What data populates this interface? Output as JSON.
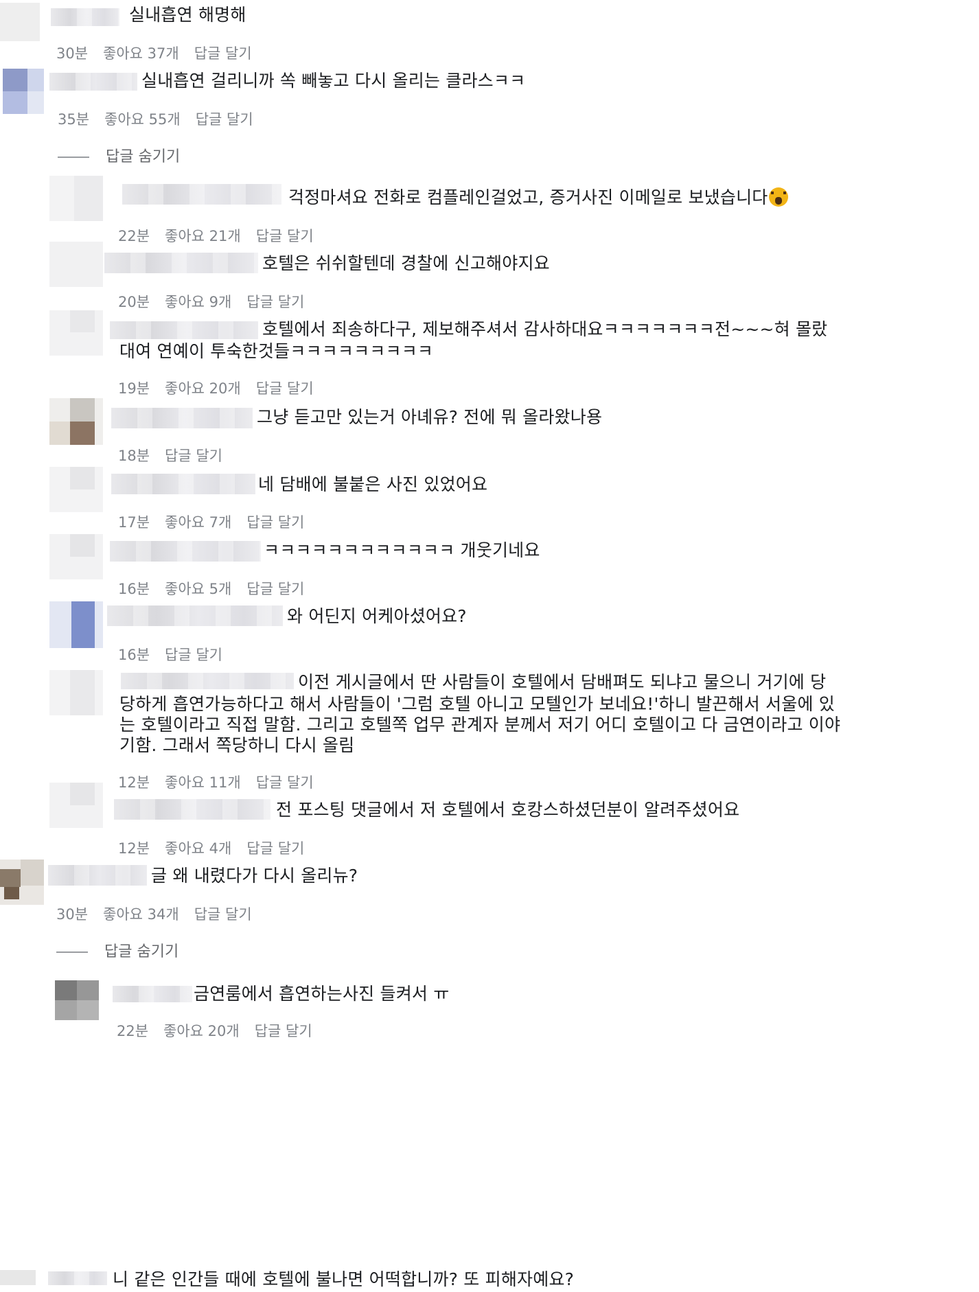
{
  "hide_replies_label": "답글 숨기기",
  "comments": [
    {
      "text": "실내흡연 해명해",
      "time": "30분",
      "likes": "좋아요 37개",
      "reply": "답글 달기"
    },
    {
      "text": "실내흡연 걸리니까 쏙 빼놓고 다시 올리는 클라스ㅋㅋ",
      "time": "35분",
      "likes": "좋아요 55개",
      "reply": "답글 달기"
    },
    {
      "text": "걱정마셔요 전화로 컴플레인걸었고, 증거사진 이메일로 보냈습니다",
      "emoji": "face-screaming-icon",
      "time": "22분",
      "likes": "좋아요 21개",
      "reply": "답글 달기"
    },
    {
      "text": "호텔은 쉬쉬할텐데 경찰에 신고해야지요",
      "time": "20분",
      "likes": "좋아요 9개",
      "reply": "답글 달기"
    },
    {
      "text": "호텔에서 죄송하다구, 제보해주셔서 감사하대요ㅋㅋㅋㅋㅋㅋㅋ전~~~혀 몰랐",
      "text2": "대여 연예이 투숙한것들ㅋㅋㅋㅋㅋㅋㅋㅋㅋ",
      "time": "19분",
      "likes": "좋아요 20개",
      "reply": "답글 달기"
    },
    {
      "text": "그냥 듣고만 있는거 아녜유? 전에 뭐 올라왔나용",
      "time": "18분",
      "reply": "답글 달기"
    },
    {
      "text": "네 담배에 불붙은 사진 있었어요",
      "time": "17분",
      "likes": "좋아요 7개",
      "reply": "답글 달기"
    },
    {
      "text": "ㅋㅋㅋㅋㅋㅋㅋㅋㅋㅋㅋㅋ 개웃기네요",
      "time": "16분",
      "likes": "좋아요 5개",
      "reply": "답글 달기"
    },
    {
      "text": "와 어딘지 어케아셨어요?",
      "time": "16분",
      "reply": "답글 달기"
    },
    {
      "text": "이전 게시글에서 딴 사람들이 호텔에서 담배펴도 되냐고 물으니 거기에 당",
      "text2": "당하게 흡연가능하다고 해서 사람들이 '그럼 호텔 아니고 모텔인가 보네요!'하니 발끈해서 서울에 있",
      "text3": "는 호텔이라고 직접 말함. 그리고 호텔쪽 업무 관계자 분께서 저기 어디 호텔이고 다 금연이라고 이야",
      "text4": "기함. 그래서 쪽당하니 다시 올림",
      "time": "12분",
      "likes": "좋아요 11개",
      "reply": "답글 달기"
    },
    {
      "text": "전 포스팅 댓글에서 저 호텔에서 호캉스하셨던분이 알려주셨어요",
      "time": "12분",
      "likes": "좋아요 4개",
      "reply": "답글 달기"
    },
    {
      "text": "글 왜 내렸다가 다시 올리뉴?",
      "time": "30분",
      "likes": "좋아요 34개",
      "reply": "답글 달기"
    },
    {
      "text": "금연룸에서 흡연하는사진 들켜서 ㅠ",
      "time": "22분",
      "likes": "좋아요 20개",
      "reply": "답글 달기"
    },
    {
      "text": "니 같은 인간들 때에 호텔에 불나면 어떡합니까? 또 피해자예요?"
    }
  ]
}
